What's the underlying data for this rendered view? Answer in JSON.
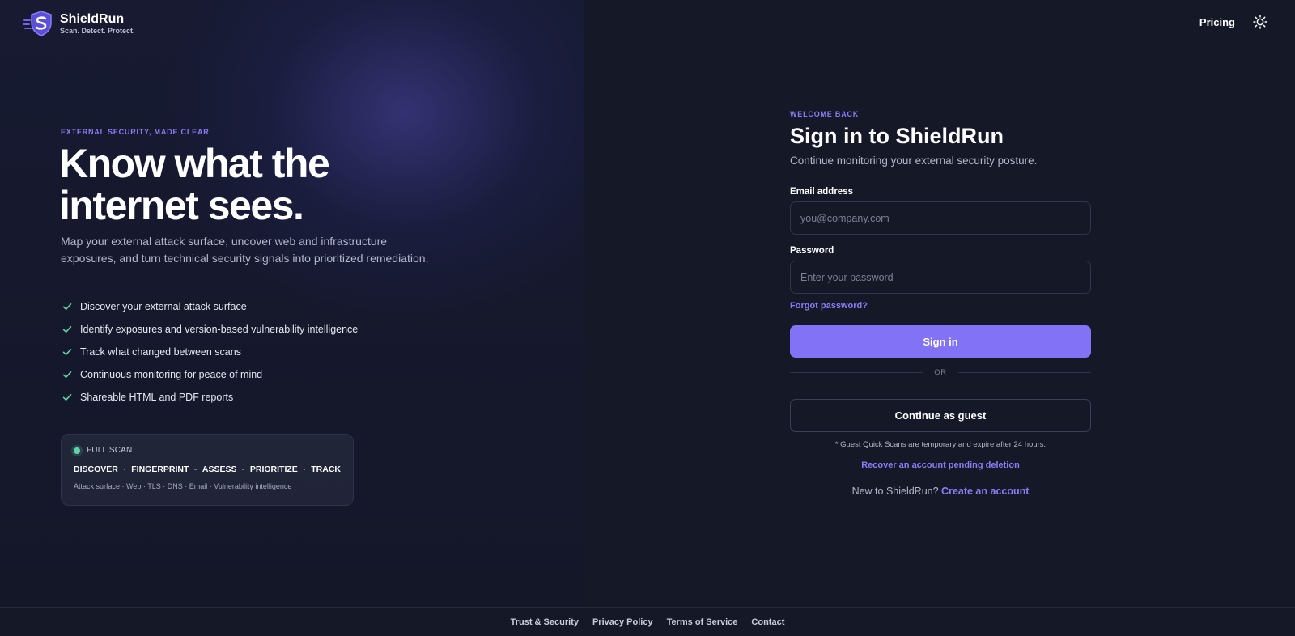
{
  "header": {
    "brand_name": "ShieldRun",
    "brand_tagline": "Scan. Detect. Protect.",
    "pricing_label": "Pricing",
    "theme_icon": "sun-icon",
    "logo_icon": "shield-s-icon"
  },
  "hero": {
    "eyebrow": "EXTERNAL SECURITY, MADE CLEAR",
    "title_line1": "Know what the",
    "title_line2": "internet sees.",
    "subtitle": "Map your external attack surface, uncover web and infrastructure exposures, and turn technical security signals into prioritized remediation.",
    "features": [
      "Discover your external attack surface",
      "Identify exposures and version-based vulnerability intelligence",
      "Track what changed between scans",
      "Continuous monitoring for peace of mind",
      "Shareable HTML and PDF reports"
    ],
    "feature_icon": "check-icon"
  },
  "scan_card": {
    "label": "FULL SCAN",
    "steps": [
      "DISCOVER",
      "FINGERPRINT",
      "ASSESS",
      "PRIORITIZE",
      "TRACK"
    ],
    "meta": "Attack surface · Web · TLS · DNS · Email · Vulnerability intelligence"
  },
  "signin": {
    "eyebrow": "WELCOME BACK",
    "title": "Sign in to ShieldRun",
    "subtitle": "Continue monitoring your external security posture.",
    "email_label": "Email address",
    "email_placeholder": "you@company.com",
    "email_value": "",
    "password_label": "Password",
    "password_placeholder": "Enter your password",
    "password_value": "",
    "forgot_label": "Forgot password?",
    "submit_label": "Sign in",
    "or_label": "OR",
    "guest_label": "Continue as guest",
    "guest_note": "* Guest Quick Scans are temporary and expire after 24 hours.",
    "recover_label": "Recover an account pending deletion",
    "new_prompt": "New to ShieldRun?",
    "create_label": "Create an account"
  },
  "footer": {
    "links": [
      "Trust & Security",
      "Privacy Policy",
      "Terms of Service",
      "Contact"
    ]
  },
  "colors": {
    "accent": "#8272f5",
    "link": "#8b7cf6",
    "background": "#141827",
    "status_dot": "#5fd3a8"
  }
}
